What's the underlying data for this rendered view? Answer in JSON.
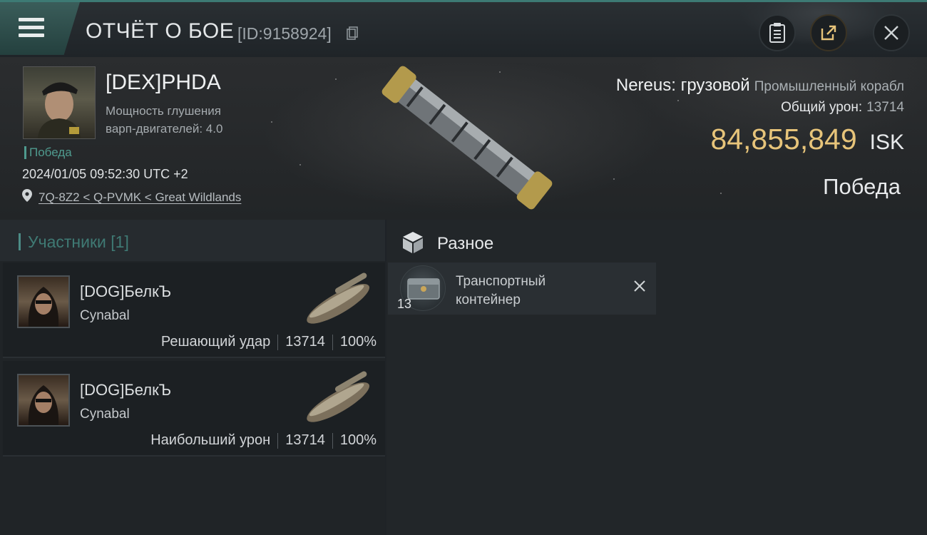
{
  "header": {
    "title": "ОТЧЁТ О БОЕ",
    "report_id": "[ID:9158924]",
    "accent_color": "#3d7a74"
  },
  "victim": {
    "name": "[DEX]PHDA",
    "stat_line1": "Мощность глушения",
    "stat_line2": "варп-двигателей: 4.0",
    "result_small": "Победа",
    "datetime": "2024/01/05 09:52:30 UTC +2",
    "location": "7Q-8Z2 < Q-PVMK < Great Wildlands",
    "ship_name": "Nereus: грузовой",
    "ship_class": "Промышленный корабл",
    "total_damage_label": "Общий урон:",
    "total_damage_value": "13714",
    "isk_value": "84,855,849",
    "isk_unit": "ISK",
    "result_big": "Победа"
  },
  "participants": {
    "title": "Участники [1]",
    "rows": [
      {
        "name": "[DOG]БелкЪ",
        "ship": "Cynabal",
        "role": "Решающий удар",
        "damage": "13714",
        "percent": "100%"
      },
      {
        "name": "[DOG]БелкЪ",
        "ship": "Cynabal",
        "role": "Наибольший урон",
        "damage": "13714",
        "percent": "100%"
      }
    ]
  },
  "misc": {
    "title": "Разное",
    "items": [
      {
        "name_line1": "Транспортный",
        "name_line2": "контейнер",
        "quantity": "13"
      }
    ]
  },
  "icons": [
    "menu-icon",
    "copy-icon",
    "clipboard-icon",
    "share-icon",
    "close-icon",
    "location-pin-icon",
    "box-icon",
    "remove-icon"
  ],
  "colors": {
    "isk": "#e7c47a",
    "result_small": "#4f9a8e",
    "participants_title": "#3f7a74"
  }
}
